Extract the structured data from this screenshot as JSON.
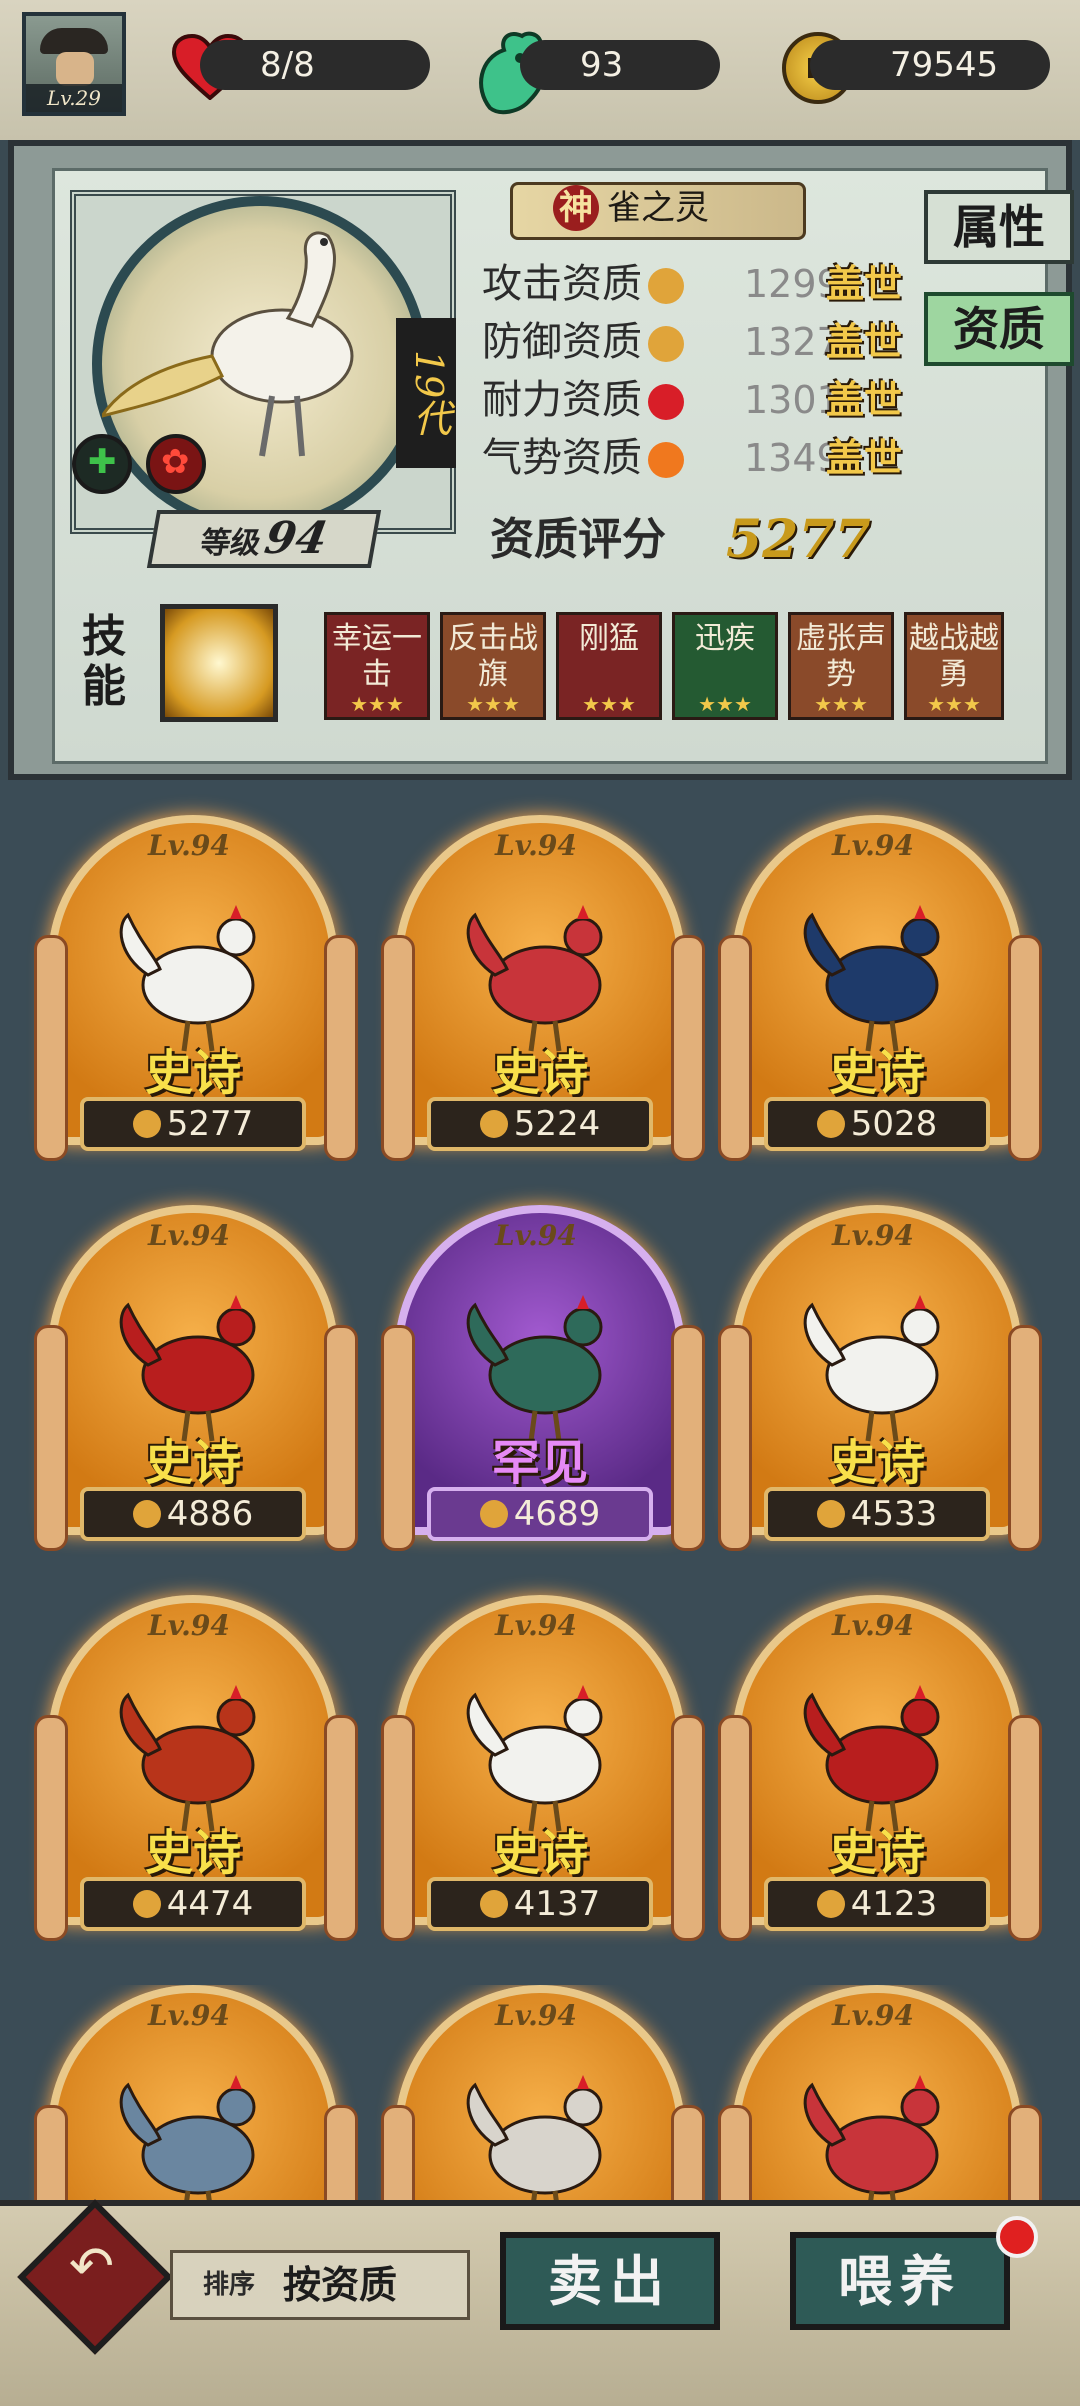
{
  "player": {
    "level": "Lv.29"
  },
  "resources": {
    "stamina": "8/8",
    "jade": "93",
    "coins": "79545"
  },
  "detail": {
    "name_prefix": "神",
    "name": "雀之灵",
    "generation": "19代",
    "level_label": "等级",
    "level": "94",
    "stats": [
      {
        "label": "攻击资质",
        "value": "1299",
        "grade": "盖世"
      },
      {
        "label": "防御资质",
        "value": "1327",
        "grade": "盖世"
      },
      {
        "label": "耐力资质",
        "value": "1301",
        "grade": "盖世"
      },
      {
        "label": "气势资质",
        "value": "1349",
        "grade": "盖世"
      }
    ],
    "score_label": "资质评分",
    "score": "5277",
    "tabs": {
      "attributes": "属性",
      "quality": "资质"
    },
    "skills_label": "技能",
    "skills": [
      {
        "name": "幸运一击",
        "stars": "★★★"
      },
      {
        "name": "反击战旗",
        "stars": "★★★"
      },
      {
        "name": "刚猛",
        "stars": "★★★"
      },
      {
        "name": "迅疾",
        "stars": "★★★"
      },
      {
        "name": "虚张声势",
        "stars": "★★★"
      },
      {
        "name": "越战越勇",
        "stars": "★★★"
      }
    ]
  },
  "roster": [
    {
      "level": "Lv.94",
      "rarity": "史诗",
      "score": "5277",
      "color": "#f2f2ee"
    },
    {
      "level": "Lv.94",
      "rarity": "史诗",
      "score": "5224",
      "color": "#c8343a"
    },
    {
      "level": "Lv.94",
      "rarity": "史诗",
      "score": "5028",
      "color": "#1e3a6a"
    },
    {
      "level": "Lv.94",
      "rarity": "史诗",
      "score": "4886",
      "color": "#b81e1e"
    },
    {
      "level": "Lv.94",
      "rarity": "罕见",
      "score": "4689",
      "color": "#2e6a5a"
    },
    {
      "level": "Lv.94",
      "rarity": "史诗",
      "score": "4533",
      "color": "#f2f2ee"
    },
    {
      "level": "Lv.94",
      "rarity": "史诗",
      "score": "4474",
      "color": "#b8341a"
    },
    {
      "level": "Lv.94",
      "rarity": "史诗",
      "score": "4137",
      "color": "#f2f2ee"
    },
    {
      "level": "Lv.94",
      "rarity": "史诗",
      "score": "4123",
      "color": "#b81e1e"
    },
    {
      "level": "Lv.94",
      "rarity": "",
      "score": "",
      "color": "#6a86a0"
    },
    {
      "level": "Lv.94",
      "rarity": "",
      "score": "",
      "color": "#d8d4cc"
    },
    {
      "level": "Lv.94",
      "rarity": "",
      "score": "",
      "color": "#c8343a"
    }
  ],
  "bottom": {
    "sort_label": "排序",
    "sort_value": "按资质",
    "sell": "卖出",
    "feed": "喂养",
    "back_icon": "↶"
  }
}
